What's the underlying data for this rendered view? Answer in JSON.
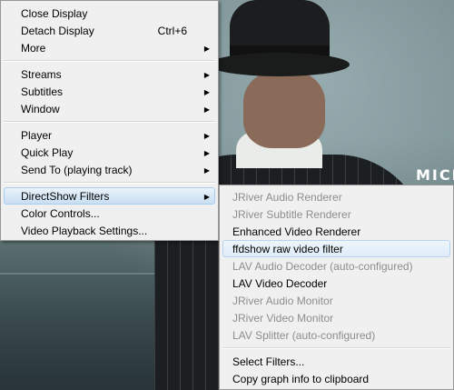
{
  "video": {
    "overlay_text": "MICI"
  },
  "main_menu": {
    "groups": [
      [
        {
          "label": "Close Display",
          "shortcut": "",
          "has_submenu": false
        },
        {
          "label": "Detach Display",
          "shortcut": "Ctrl+6",
          "has_submenu": false
        },
        {
          "label": "More",
          "shortcut": "",
          "has_submenu": true
        }
      ],
      [
        {
          "label": "Streams",
          "has_submenu": true
        },
        {
          "label": "Subtitles",
          "has_submenu": true
        },
        {
          "label": "Window",
          "has_submenu": true
        }
      ],
      [
        {
          "label": "Player",
          "has_submenu": true
        },
        {
          "label": "Quick Play",
          "has_submenu": true
        },
        {
          "label": "Send To (playing track)",
          "has_submenu": true
        }
      ],
      [
        {
          "label": "DirectShow Filters",
          "has_submenu": true,
          "active": true
        },
        {
          "label": "Color Controls...",
          "has_submenu": false
        },
        {
          "label": "Video Playback Settings...",
          "has_submenu": false
        }
      ]
    ],
    "arrow_glyph": "▶"
  },
  "sub_menu": {
    "filters": [
      {
        "label": "JRiver Audio Renderer",
        "enabled": false
      },
      {
        "label": "JRiver Subtitle Renderer",
        "enabled": false
      },
      {
        "label": "Enhanced Video Renderer",
        "enabled": true
      },
      {
        "label": "ffdshow raw video filter",
        "enabled": true,
        "highlighted": true
      },
      {
        "label": "LAV Audio Decoder (auto-configured)",
        "enabled": false
      },
      {
        "label": "LAV Video Decoder",
        "enabled": true
      },
      {
        "label": "JRiver Audio Monitor",
        "enabled": false
      },
      {
        "label": "JRiver Video Monitor",
        "enabled": false
      },
      {
        "label": "LAV Splitter (auto-configured)",
        "enabled": false
      }
    ],
    "actions": [
      {
        "label": "Select Filters..."
      },
      {
        "label": "Copy graph info to clipboard"
      }
    ]
  }
}
